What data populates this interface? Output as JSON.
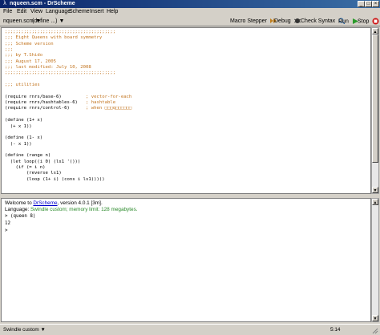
{
  "window": {
    "title": "nqueen.scm - DrScheme",
    "app_icon": "λ",
    "minimize_glyph": "_",
    "maximize_glyph": "□",
    "close_glyph": "×"
  },
  "menubar": {
    "items": [
      "File",
      "Edit",
      "View",
      "Language",
      "Scheme",
      "Insert",
      "Help"
    ]
  },
  "toolbar": {
    "file_dropdown": "nqueen.scm ▼",
    "define_dropdown": "(define ...) ▼",
    "macro_stepper": "Macro Stepper",
    "debug": "Debug",
    "check_syntax": "Check Syntax",
    "run": "Run",
    "stop": "Stop",
    "colors": {
      "run": "#2a9a2a",
      "stop": "#cc1111",
      "macro": "#c08020"
    }
  },
  "editor": {
    "lines": [
      {
        "t": ";;;;;;;;;;;;;;;;;;;;;;;;;;;;;;;;;;;;;;;;;",
        "c": true
      },
      {
        "t": ";;; Eight Queens with board symmetry",
        "c": true
      },
      {
        "t": ";;; Scheme version",
        "c": true
      },
      {
        "t": ";;;",
        "c": true
      },
      {
        "t": ";;; by T.Shido",
        "c": true
      },
      {
        "t": ";;; August 17, 2005",
        "c": true
      },
      {
        "t": ";;; last modified: July 10, 2008",
        "c": true
      },
      {
        "t": ";;;;;;;;;;;;;;;;;;;;;;;;;;;;;;;;;;;;;;;;;",
        "c": true
      },
      {
        "t": "",
        "c": false
      },
      {
        "t": ";;; utilities",
        "c": true
      },
      {
        "t": "",
        "c": false
      },
      {
        "t": "(require rnrs/base-6)",
        "c": false,
        "tail": "         ; vector-for-each"
      },
      {
        "t": "(require rnrs/hashtables-6)",
        "c": false,
        "tail": "   ; hashtable"
      },
      {
        "t": "(require rnrs/control-6)",
        "c": false,
        "tail": "      ; when □□□q□□□□□□"
      },
      {
        "t": "",
        "c": false
      },
      {
        "t": "(define (1+ x)",
        "c": false
      },
      {
        "t": "  (+ x 1))",
        "c": false
      },
      {
        "t": "",
        "c": false
      },
      {
        "t": "(define (1- x)",
        "c": false
      },
      {
        "t": "  (- x 1))",
        "c": false
      },
      {
        "t": "",
        "c": false
      },
      {
        "t": "(define (range n)",
        "c": false
      },
      {
        "t": "  (let loop((i 0) (ls1 '()))",
        "c": false
      },
      {
        "t": "    (if (= i n)",
        "c": false
      },
      {
        "t": "        (reverse ls1)",
        "c": false
      },
      {
        "t": "        (loop (1+ i) (cons i ls1)))))",
        "c": false
      }
    ]
  },
  "repl": {
    "welcome_prefix": "Welcome to ",
    "welcome_link": "DrScheme",
    "welcome_suffix": ", version 4.0.1 [3m].",
    "language_prefix": "Language: ",
    "language_value": "Swindle custom; memory limit: 128 megabytes.",
    "prompt_line": ">  (queen 8)",
    "result": "12",
    "prompt": ">"
  },
  "statusbar": {
    "language": "Swindle custom ▼",
    "position": "5:14"
  }
}
